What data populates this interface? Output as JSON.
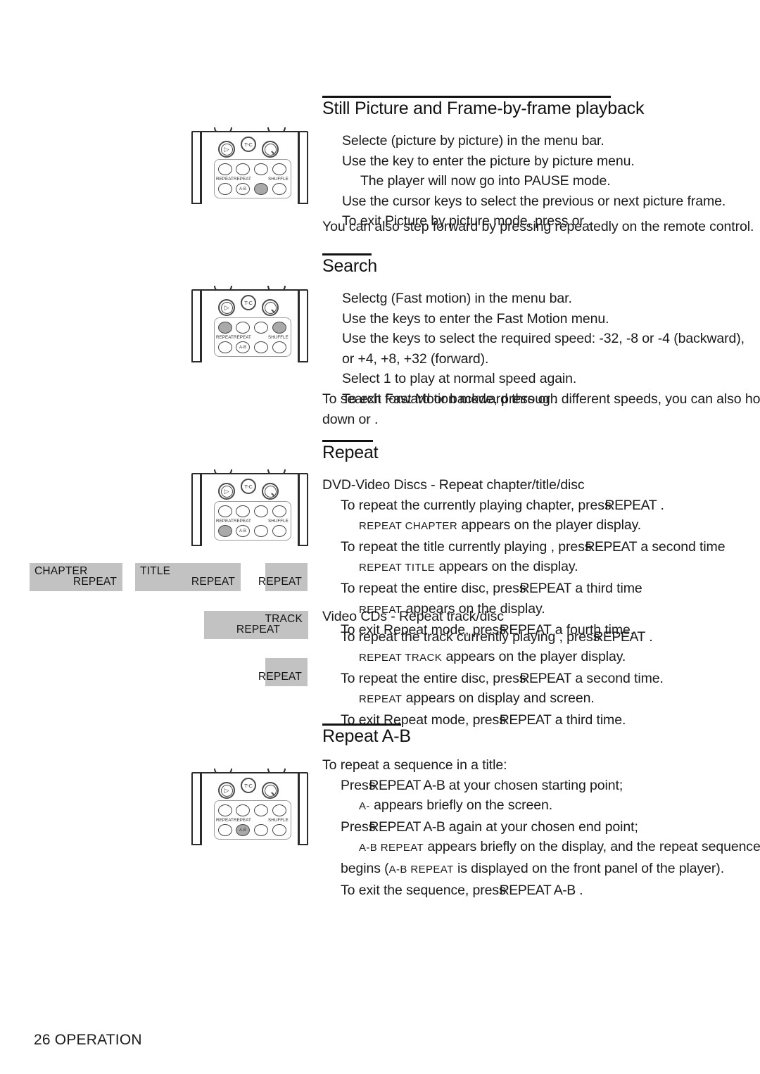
{
  "document": {
    "footer_page_number": "26",
    "footer_section": "OPERATION",
    "footer_text": "26 OPERATION"
  },
  "sections": {
    "still_picture": {
      "heading": "Still Picture and Frame-by-frame playback",
      "lines": [
        "Selecte      (picture by picture) in the menu bar.",
        "Use the    key to enter the picture by picture menu.",
        "The player will now go into PAUSE mode.",
        "Use the cursor keys       to select the previous or next picture frame.",
        "To exit Picture by picture mode, press or     ."
      ],
      "note": "You can also step forward by pressing repeatedly on the remote control."
    },
    "search": {
      "heading": "Search",
      "lines": [
        "Selectg      (Fast motion) in the menu bar.",
        "Use the    keys to enter the Fast Motion menu.",
        "Use the       keys to select the required speed: -32, -8 or -4 (backward),",
        "or +4, +8, +32 (forward).",
        "Select 1 to play at normal speed again.",
        "To exit Fast Motion mode, press or    ."
      ],
      "note_line1": "To search forward or backward through different speeds, you can also hold",
      "note_line2": "down        or        ."
    },
    "repeat": {
      "heading": "Repeat",
      "dvd_subheading": "DVD-Video Discs - Repeat chapter/title/disc",
      "dvd_lines": [
        {
          "pre": "To repeat the currently playing chapter, press",
          "btn": "REPEAT",
          "post": "."
        },
        {
          "sc": "REPEAT CHAPTER",
          "post": "appears on the player display."
        },
        {
          "pre": "To repeat the title currently playing , press",
          "btn": "REPEAT",
          "post": "a second time"
        },
        {
          "sc": "REPEAT TITLE",
          "post": "appears on the display."
        },
        {
          "pre": "To repeat the entire disc, press",
          "btn": "REPEAT",
          "post": "a third time"
        },
        {
          "sc": "REPEAT",
          "post": "appears on the display."
        },
        {
          "pre": "To exit Repeat mode, press",
          "btn": "REPEAT",
          "post": "a fourth time."
        }
      ],
      "vcd_subheading": "Video CDs - Repeat track/disc",
      "vcd_lines": [
        {
          "pre": "To repeat the track currently playing , press",
          "btn": "REPEAT",
          "post": "."
        },
        {
          "sc": "REPEAT TRACK",
          "post": "appears on the player display."
        },
        {
          "pre": "To repeat the entire disc, press",
          "btn": "REPEAT",
          "post": "a second time."
        },
        {
          "sc": "REPEAT",
          "post": "appears on display and screen."
        },
        {
          "pre": "To exit Repeat mode, press",
          "btn": "REPEAT",
          "post": "a third time."
        }
      ]
    },
    "repeat_ab": {
      "heading": "Repeat A-B",
      "intro": "To repeat a sequence in a title:",
      "lines": [
        {
          "pre": "Press",
          "btn": "REPEAT A-B",
          "post": "at your chosen starting point;"
        },
        {
          "sc": "A-",
          "post": "appears briefly on the screen."
        },
        {
          "pre": "Press",
          "btn": "REPEAT A-B",
          "post": "again at your chosen end point;"
        },
        {
          "sc": "A-B REPEAT",
          "post": "appears briefly on the display, and the repeat sequence"
        },
        {
          "pre": "begins (",
          "sc": "A-B REPEAT",
          "post": "is displayed on the front panel of the player)."
        },
        {
          "pre": "To exit the sequence, press",
          "btn": "REPEAT A-B",
          "post": "."
        }
      ]
    }
  },
  "display_boxes": [
    {
      "name": "chapter-repeat",
      "top_left": "CHAPTER",
      "bottom_right": "REPEAT"
    },
    {
      "name": "title-repeat",
      "top_left": "TITLE",
      "bottom_right": "REPEAT"
    },
    {
      "name": "repeat-disc",
      "bottom_right": "REPEAT"
    },
    {
      "name": "track-repeat",
      "top_right": "TRACK",
      "bottom_center": "REPEAT"
    },
    {
      "name": "repeat-vcd-disc",
      "bottom_right": "REPEAT"
    }
  ],
  "remotes": [
    {
      "name": "remote-still-picture",
      "step_glyph": "▷",
      "tc_label": "T-C",
      "keypad_labels": {
        "repeat1": "REPEAT",
        "repeat2": "REPEAT",
        "ab": "A-B",
        "shuffle": "SHUFFLE"
      },
      "highlighted": [
        "row2-col3"
      ]
    },
    {
      "name": "remote-search",
      "step_glyph": "▷",
      "tc_label": "T-C",
      "keypad_labels": {
        "repeat1": "REPEAT",
        "repeat2": "REPEAT",
        "ab": "A-B",
        "shuffle": "SHUFFLE"
      },
      "highlighted": [
        "row1-col1",
        "row1-col4"
      ]
    },
    {
      "name": "remote-repeat",
      "step_glyph": "▷",
      "tc_label": "T-C",
      "keypad_labels": {
        "repeat1": "REPEAT",
        "repeat2": "REPEAT",
        "ab": "A-B",
        "shuffle": "SHUFFLE"
      },
      "highlighted": [
        "row2-col1"
      ]
    },
    {
      "name": "remote-repeat-ab",
      "step_glyph": "▷",
      "tc_label": "T-C",
      "keypad_labels": {
        "repeat1": "REPEAT",
        "repeat2": "REPEAT",
        "ab": "A-B",
        "shuffle": "SHUFFLE"
      },
      "highlighted": [
        "row2-col2"
      ]
    }
  ]
}
